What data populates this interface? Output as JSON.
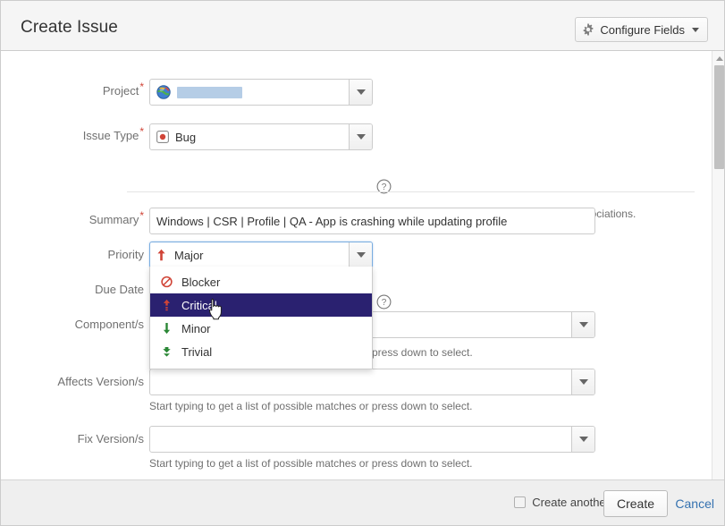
{
  "header": {
    "title": "Create Issue",
    "configure_fields_label": "Configure Fields",
    "gear_icon": "gear-icon",
    "caret_icon": "chevron-down-icon"
  },
  "form": {
    "project": {
      "label": "Project",
      "required": true,
      "icon": "project-globe-icon",
      "value": "",
      "redacted": true
    },
    "issue_type": {
      "label": "Issue Type",
      "required": true,
      "icon": "bug-icon",
      "value": "Bug",
      "help_icon": "question-circle-icon",
      "description": "Some issue types are unavailable due to incompatible field configuration and/or workflow associations."
    },
    "summary": {
      "label": "Summary",
      "required": true,
      "value": "Windows | CSR | Profile | QA - App is crashing while updating profile"
    },
    "priority": {
      "label": "Priority",
      "required": false,
      "value": "Major",
      "icon": "priority-major-arrow-up-icon",
      "help_icon": "question-circle-icon",
      "expanded": true,
      "options": [
        {
          "label": "Blocker",
          "icon": "priority-blocker-no-entry-icon",
          "selected": false
        },
        {
          "label": "Critical",
          "icon": "priority-critical-arrow-up-icon",
          "selected": true
        },
        {
          "label": "Minor",
          "icon": "priority-minor-arrow-down-icon",
          "selected": false
        },
        {
          "label": "Trivial",
          "icon": "priority-trivial-double-arrow-down-icon",
          "selected": false
        }
      ]
    },
    "due_date": {
      "label": "Due Date",
      "required": false,
      "value": ""
    },
    "components": {
      "label": "Component/s",
      "required": false,
      "value": "",
      "help_text": "press down to select."
    },
    "affects_versions": {
      "label": "Affects Version/s",
      "required": false,
      "value": "",
      "help_text": "Start typing to get a list of possible matches or press down to select."
    },
    "fix_versions": {
      "label": "Fix Version/s",
      "required": false,
      "value": "",
      "help_text": "Start typing to get a list of possible matches or press down to select."
    }
  },
  "footer": {
    "create_another_label": "Create another",
    "create_another_checked": false,
    "create_label": "Create",
    "cancel_label": "Cancel"
  },
  "colors": {
    "header_bg": "#f5f5f5",
    "footer_bg": "#efefef",
    "required_star": "#d04437",
    "link": "#3572b0",
    "selected_menu_bg": "#2a2170",
    "priority_high": "#d04437",
    "priority_low": "#2a8735",
    "redaction": "#b5cde6",
    "focus_border": "#7aade0"
  },
  "scrollbar": {
    "orientation": "vertical",
    "arrow_icon": "scroll-up-arrow-icon"
  }
}
